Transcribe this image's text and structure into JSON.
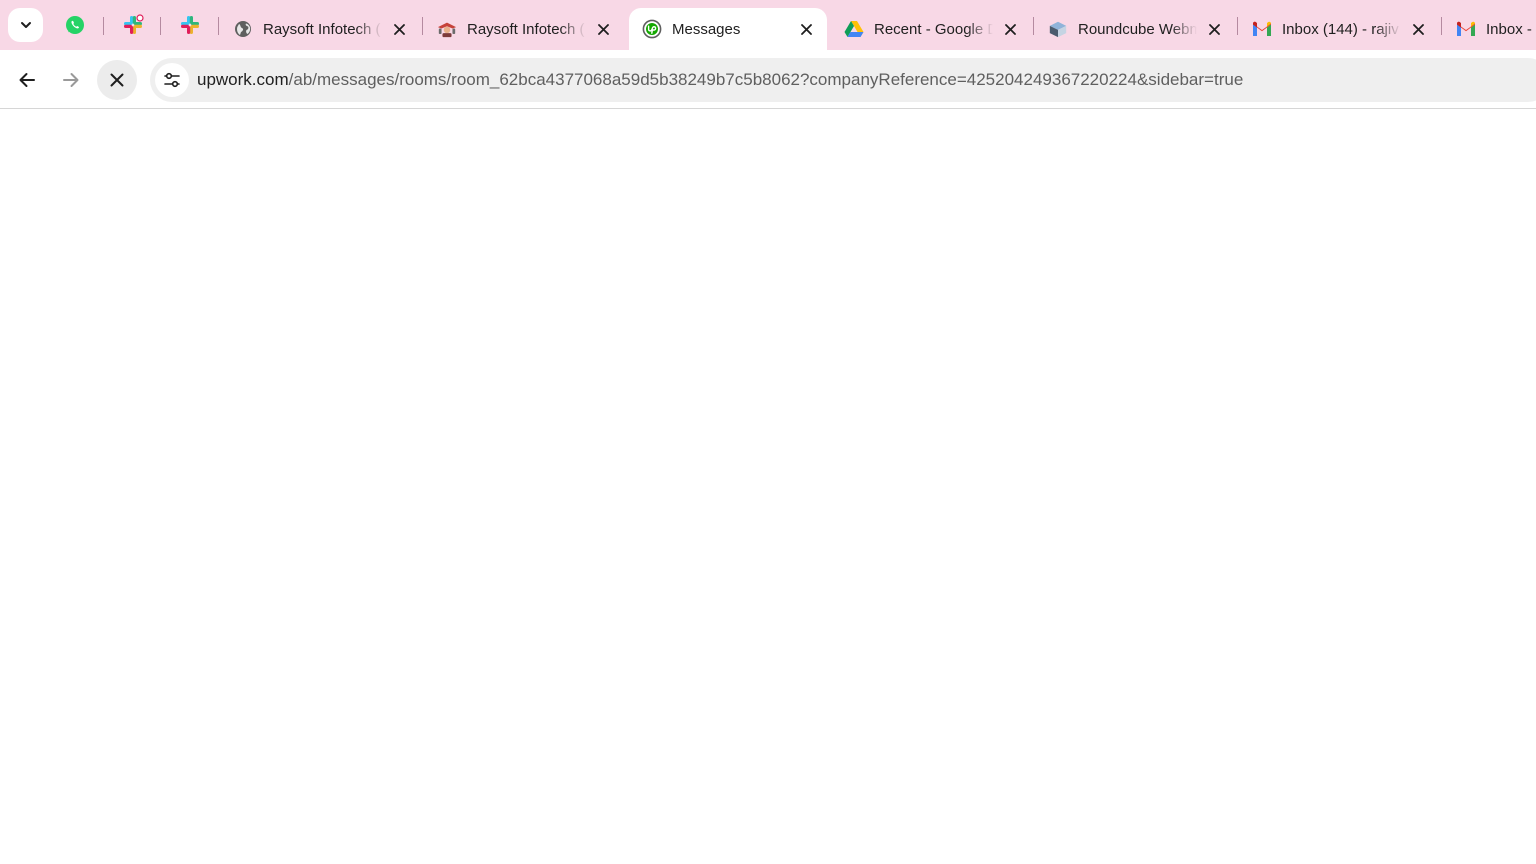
{
  "browser": {
    "tabs": [
      {
        "title": "Raysoft Infotech (",
        "icon": "globe-icon"
      },
      {
        "title": "Raysoft Infotech (",
        "icon": "raysoft-logo-icon"
      },
      {
        "title": "Messages",
        "icon": "upwork-icon",
        "active": true
      },
      {
        "title": "Recent - Google D",
        "icon": "google-drive-icon"
      },
      {
        "title": "Roundcube Webm",
        "icon": "roundcube-icon"
      },
      {
        "title": "Inbox (144) - rajiv",
        "icon": "gmail-icon"
      },
      {
        "title": "Inbox - s",
        "icon": "gmail-icon"
      }
    ],
    "pinned_tabs": [
      "whatsapp-icon",
      "slack-icon",
      "slack-icon"
    ],
    "address": {
      "host": "upwork.com",
      "path": "/ab/messages/rooms/room_62bca4377068a59d5b38249b7c5b8062?companyReference=425204249367220224&sidebar=true"
    }
  },
  "colors": {
    "tabstrip": "#f8d8e6",
    "omnibox": "#efefef",
    "upwork_green": "#14a800"
  }
}
